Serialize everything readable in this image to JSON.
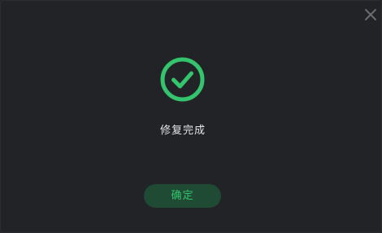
{
  "dialog": {
    "message": "修复完成",
    "confirm_label": "确定",
    "close_icon": "close-icon",
    "status_icon": "check-circle-icon"
  },
  "colors": {
    "background": "#222327",
    "accent": "#35c46e",
    "button_bg": "#1f4a33",
    "text": "#e6e6e6",
    "close_icon": "#6b6c70"
  }
}
